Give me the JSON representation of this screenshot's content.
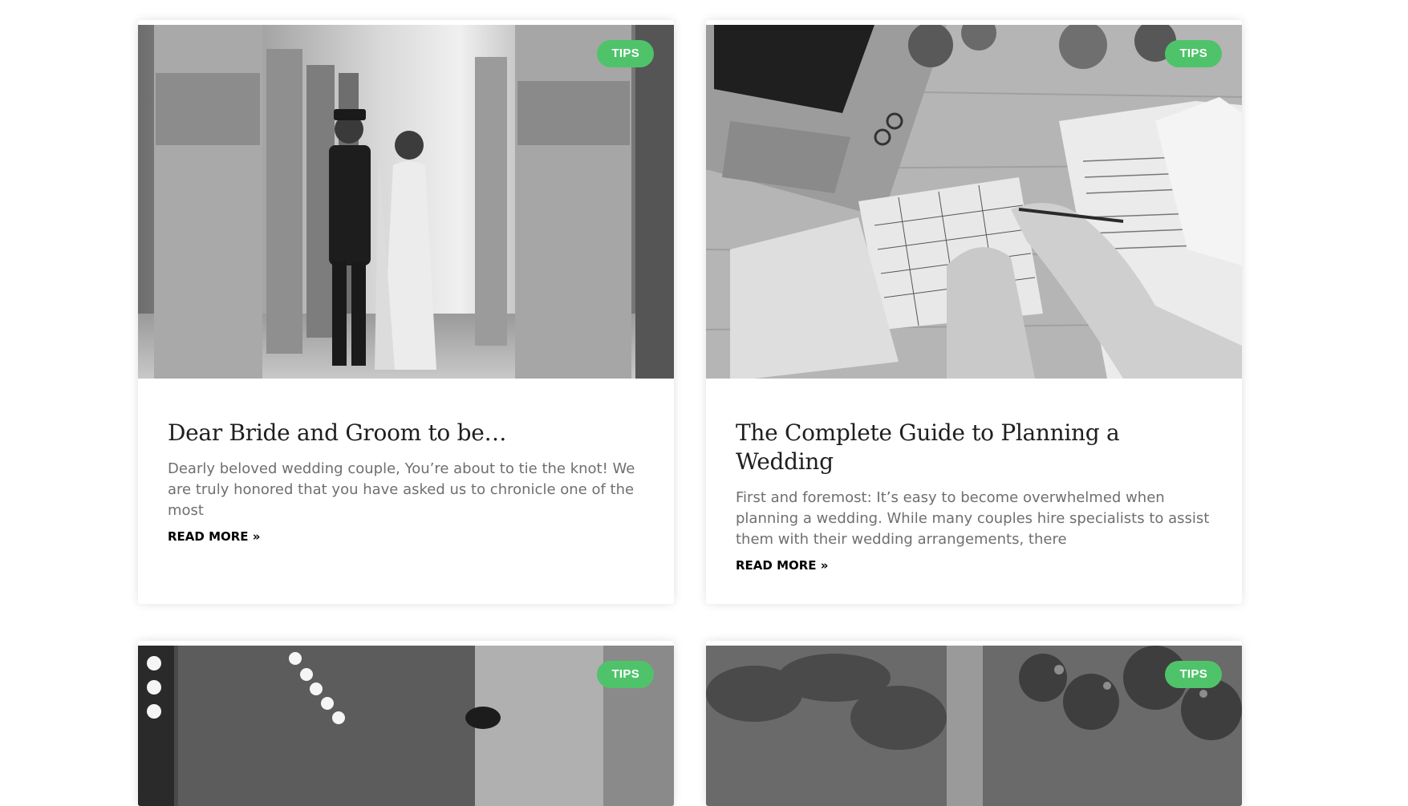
{
  "posts": [
    {
      "category": "TIPS",
      "title": "Dear Bride and Groom to be…",
      "excerpt": "Dearly beloved wedding couple, You’re about to tie the knot! We are truly honored that you have asked us to chronicle one of the most",
      "read_more": "READ MORE »",
      "image_desc": "bride-and-groom-photo"
    },
    {
      "category": "TIPS",
      "title": "The Complete Guide to Planning a Wedding",
      "excerpt": "First and foremost: It’s easy to become overwhelmed when planning a wedding. While many couples hire specialists to assist them with their wedding arrangements, there",
      "read_more": "READ MORE »",
      "image_desc": "wedding-planning-photo"
    },
    {
      "category": "TIPS",
      "image_desc": "makeup-room-photo"
    },
    {
      "category": "TIPS",
      "image_desc": "garden-photo"
    }
  ],
  "colors": {
    "badge": "#4fc36a",
    "title": "#1f1f1f",
    "excerpt": "#6f6f6f"
  }
}
